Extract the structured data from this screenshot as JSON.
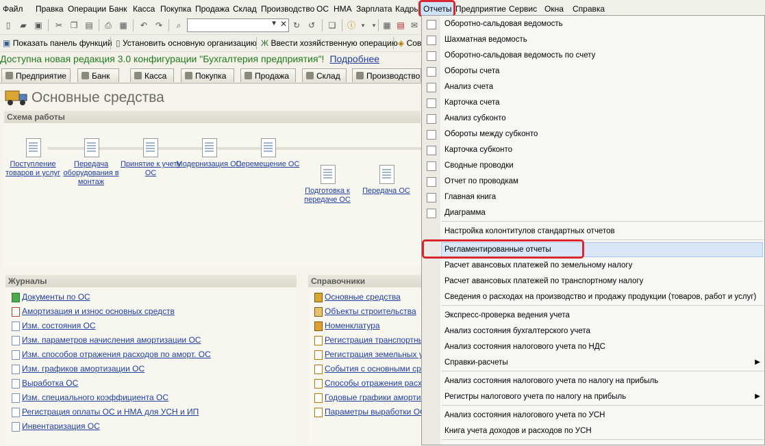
{
  "menubar": [
    "Файл",
    "Правка",
    "Операции",
    "Банк",
    "Касса",
    "Покупка",
    "Продажа",
    "Склад",
    "Производство",
    "ОС",
    "НМА",
    "Зарплата",
    "Кадры",
    "Отчеты",
    "Предприятие",
    "Сервис",
    "Окна",
    "Справка"
  ],
  "toolbar2": {
    "show_panel": "Показать панель функций",
    "set_org": "Установить основную организацию",
    "enter_op": "Ввести хозяйственную операцию",
    "cut_item": "Сов"
  },
  "notice": {
    "text": "Доступна новая редакция 3.0 конфигурации \"Бухгалтерия предприятия\"!",
    "link": "Подробнее"
  },
  "tabs": [
    "Предприятие",
    "Банк",
    "Касса",
    "Покупка",
    "Продажа",
    "Склад",
    "Производство"
  ],
  "page": {
    "title": "Основные средства",
    "scheme_title": "Схема работы",
    "journals_title": "Журналы",
    "refs_title": "Справочники"
  },
  "scheme_steps": [
    "Поступление товаров и услуг",
    "Передача оборудования в монтаж",
    "Принятие к учету ОС",
    "Модернизация ОС",
    "Перемещение ОС",
    "Подготовка к передаче ОС",
    "Передача ОС"
  ],
  "journals": [
    "Документы по ОС",
    "Амортизация и износ основных средств",
    "Изм. состояния ОС",
    "Изм. параметров начисления амортизации ОС",
    "Изм. способов отражения расходов по аморт. ОС",
    "Изм. графиков амортизации ОС",
    "Выработка ОС",
    "Изм. специального коэффициента ОС",
    "Регистрация оплаты ОС и НМА для УСН и ИП",
    "Инвентаризация ОС"
  ],
  "references": [
    "Основные средства",
    "Объекты строительства",
    "Номенклатура",
    "Регистрация транспортных",
    "Регистрация земельных уча",
    "События с основными средс",
    "Способы отражения расход",
    "Годовые графики амортиза",
    "Параметры выработки ОС"
  ],
  "menu": {
    "group1": [
      "Оборотно-сальдовая ведомость",
      "Шахматная ведомость",
      "Оборотно-сальдовая ведомость по счету",
      "Обороты счета",
      "Анализ счета",
      "Карточка счета",
      "Анализ субконто",
      "Обороты между субконто",
      "Карточка субконто",
      "Сводные проводки",
      "Отчет по проводкам",
      "Главная книга",
      "Диаграмма"
    ],
    "group2": [
      "Настройка колонтитулов стандартных отчетов"
    ],
    "group3": [
      "Регламентированные отчеты",
      "Расчет авансовых платежей по земельному налогу",
      "Расчет авансовых платежей по транспортному налогу",
      "Сведения о расходах на производство и продажу продукции (товаров, работ и услуг)"
    ],
    "group4": [
      "Экспресс-проверка ведения учета",
      "Анализ состояния бухгалтерского учета",
      "Анализ состояния налогового учета по НДС",
      "Справки-расчеты"
    ],
    "group5": [
      "Анализ состояния налогового учета по налогу на прибыль",
      "Регистры налогового учета по налогу на прибыль"
    ],
    "group6": [
      "Анализ состояния налогового учета по УСН",
      "Книга учета доходов и расходов по УСН"
    ]
  },
  "colors": {
    "highlight": "#d8262f",
    "link": "#1f3fa0",
    "notice": "#1f7a1f"
  }
}
